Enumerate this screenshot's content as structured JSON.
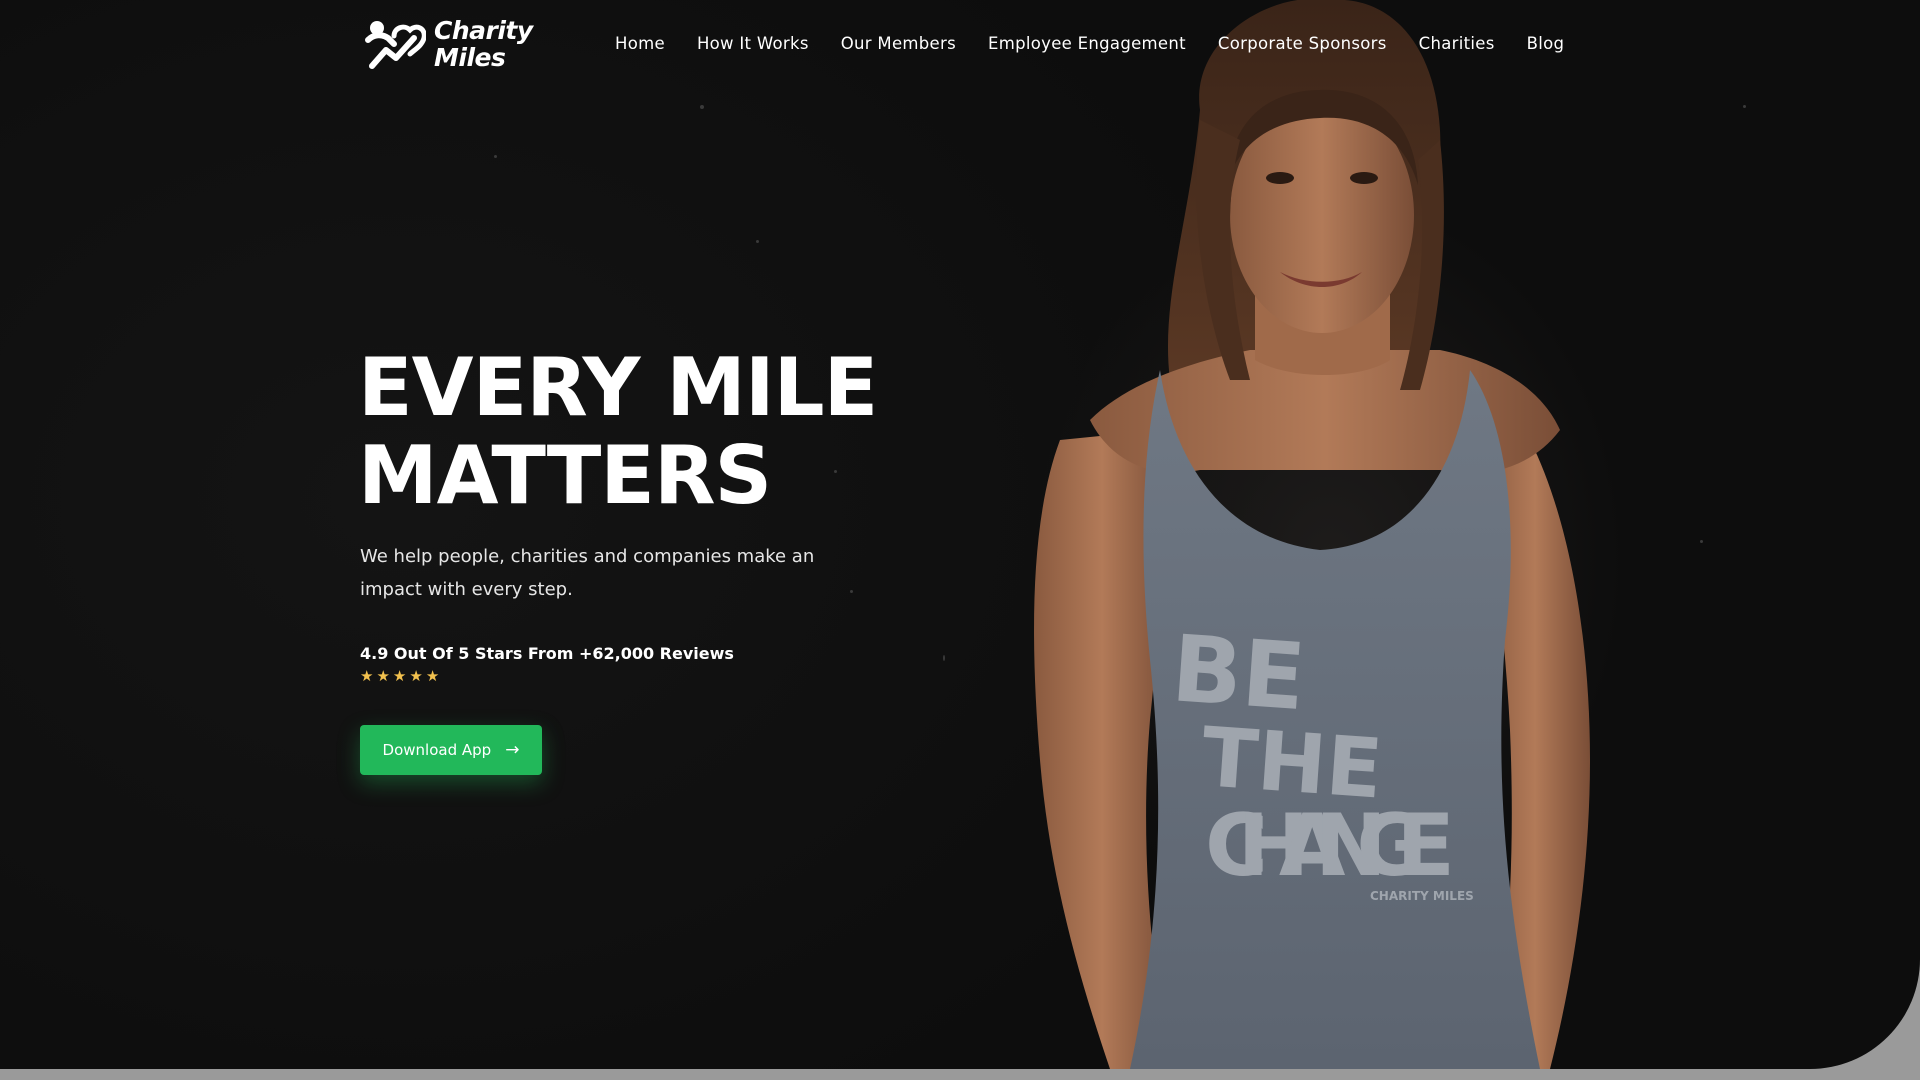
{
  "brand": {
    "name_line1": "Charity",
    "name_line2": "Miles",
    "logo_icon": "running-heart-icon"
  },
  "nav": {
    "items": [
      {
        "label": "Home"
      },
      {
        "label": "How It Works"
      },
      {
        "label": "Our Members"
      },
      {
        "label": "Employee Engagement"
      },
      {
        "label": "Corporate Sponsors"
      },
      {
        "label": "Charities"
      },
      {
        "label": "Blog"
      }
    ]
  },
  "hero": {
    "headline_line1": "EVERY MILE",
    "headline_line2": "MATTERS",
    "subhead": "We help people, charities and companies make an impact with every step.",
    "reviews_text": "4.9 Out Of 5 Stars From +62,000 Reviews",
    "stars": [
      "★",
      "★",
      "★",
      "★",
      "★"
    ],
    "cta_label": "Download App",
    "cta_icon": "arrow-right-icon"
  },
  "shirt": {
    "line1": "BE",
    "line2": "THE",
    "line3": "CHANGE",
    "tag": "CHARITY MILES"
  },
  "colors": {
    "accent": "#22b85a",
    "star": "#f2c14e",
    "background": "#111111",
    "text": "#ffffff"
  }
}
